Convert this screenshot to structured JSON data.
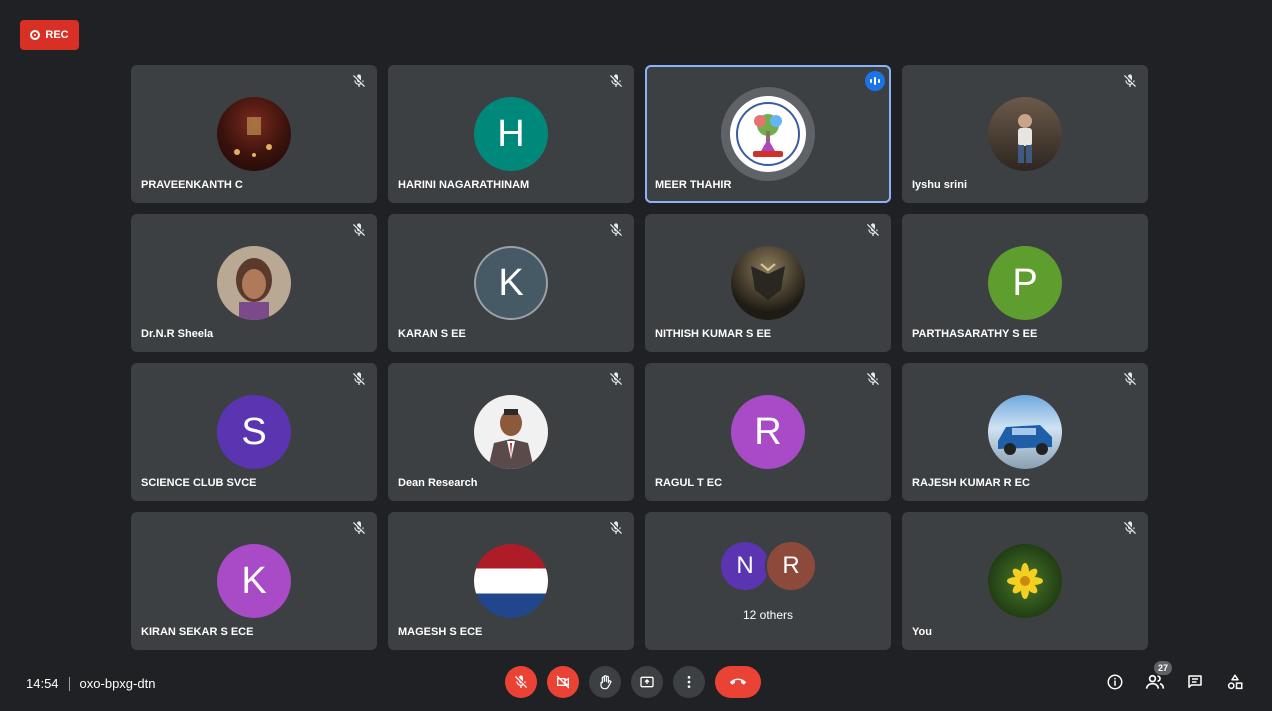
{
  "recording": {
    "label": "REC"
  },
  "tiles": [
    {
      "name": "PRAVEENKANTH C",
      "avatar": "photo"
    },
    {
      "name": "HARINI NAGARATHINAM",
      "letter": "H",
      "color": "#00897b"
    },
    {
      "name": "MEER THAHIR",
      "avatar": "science-logo",
      "speaking": true
    },
    {
      "name": "Iyshu srini",
      "avatar": "photo"
    },
    {
      "name": "Dr.N.R Sheela",
      "avatar": "photo"
    },
    {
      "name": "KARAN S EE",
      "letter": "K",
      "color": "#455a64"
    },
    {
      "name": "NITHISH KUMAR S EE",
      "avatar": "photo"
    },
    {
      "name": "PARTHASARATHY S EE",
      "letter": "P",
      "color": "#5e9e2e"
    },
    {
      "name": "SCIENCE CLUB SVCE",
      "letter": "S",
      "color": "#5b35b1"
    },
    {
      "name": "Dean Research",
      "avatar": "photo"
    },
    {
      "name": "RAGUL T EC",
      "letter": "R",
      "color": "#a94ac7"
    },
    {
      "name": "RAJESH KUMAR R EC",
      "avatar": "photo"
    },
    {
      "name": "KIRAN SEKAR S ECE",
      "letter": "K",
      "color": "#a94ac7"
    },
    {
      "name": "MAGESH S ECE",
      "avatar": "flag"
    },
    {
      "others": true,
      "letters": [
        "N",
        "R"
      ],
      "colors": [
        "#5b35b1",
        "#8d4a3a"
      ],
      "label": "12 others"
    },
    {
      "name": "You",
      "avatar": "photo"
    }
  ],
  "bottom": {
    "time": "14:54",
    "meeting_code": "oxo-bpxg-dtn",
    "participants_count": "27"
  },
  "icons": {
    "mic": "mic-off-icon",
    "camera": "camera-off-icon",
    "hand": "raise-hand-icon",
    "present": "present-icon",
    "more": "more-icon",
    "leave": "end-call-icon",
    "info": "info-icon",
    "people": "people-icon",
    "chat": "chat-icon",
    "activities": "activities-icon"
  }
}
